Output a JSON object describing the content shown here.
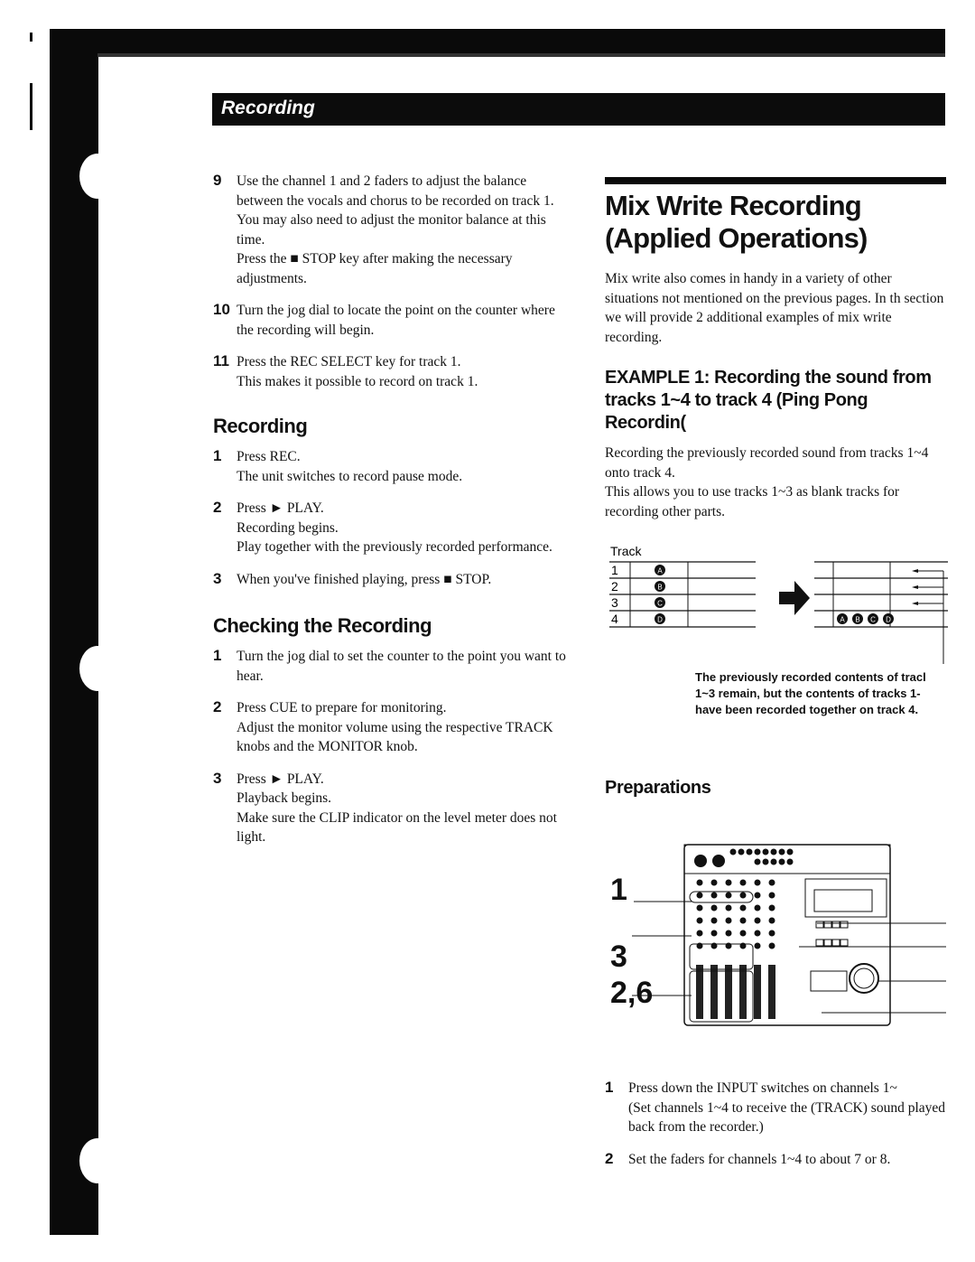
{
  "header": {
    "section": "Recording"
  },
  "left": {
    "steps_top": [
      {
        "n": "9",
        "lines": [
          "Use the channel 1 and 2 faders to adjust the balance between the vocals and chorus to be recorded on track 1.",
          "You may also need to adjust the monitor balance at this time.",
          "Press the ■ STOP key after making the necessary adjustments."
        ]
      },
      {
        "n": "10",
        "lines": [
          "Turn the jog dial to locate the point on the counter where the recording will begin."
        ]
      },
      {
        "n": "11",
        "lines": [
          "Press the REC SELECT key for track 1.",
          "This makes it possible to record on track 1."
        ]
      }
    ],
    "recording": {
      "title": "Recording",
      "steps": [
        {
          "n": "1",
          "lines": [
            "Press REC.",
            "The unit switches to record pause mode."
          ]
        },
        {
          "n": "2",
          "lines": [
            "Press ► PLAY.",
            "Recording begins.",
            "Play together with the previously recorded performance."
          ]
        },
        {
          "n": "3",
          "lines": [
            "When you've finished playing, press ■ STOP."
          ]
        }
      ]
    },
    "checking": {
      "title": "Checking the Recording",
      "steps": [
        {
          "n": "1",
          "lines": [
            "Turn the jog dial to set the counter to the point you want to hear."
          ]
        },
        {
          "n": "2",
          "lines": [
            "Press CUE to prepare for monitoring.",
            "Adjust the monitor volume using the respective TRACK knobs and the MONITOR knob."
          ]
        },
        {
          "n": "3",
          "lines": [
            "Press ► PLAY.",
            "Playback begins.",
            "Make sure the CLIP indicator on the level meter does not light."
          ]
        }
      ]
    }
  },
  "right": {
    "title": "Mix Write Recording (Applied Operations)",
    "intro": "Mix write also comes in handy in a variety of other situations not mentioned on the previous pages. In th section we will provide 2 additional examples of mix write recording.",
    "example_title": "EXAMPLE 1: Recording the sound from tracks 1~4 to track 4 (Ping Pong Recordin(",
    "example_text": [
      "Recording the previously recorded sound from tracks 1~4 onto track 4.",
      "This allows you to use tracks 1~3 as blank tracks for recording other parts."
    ],
    "diagram": {
      "track_label": "Track",
      "tracks": [
        "1",
        "2",
        "3",
        "4"
      ],
      "sources": [
        "A",
        "B",
        "C",
        "D"
      ],
      "caption": [
        "The previously recorded contents of tracl",
        "1~3 remain, but the contents of tracks 1-",
        "have been recorded together on track 4."
      ]
    },
    "prep_title": "Preparations",
    "callouts": [
      "1",
      "3",
      "2,6"
    ],
    "steps": [
      {
        "n": "1",
        "lines": [
          "Press down the INPUT switches on channels 1~",
          "(Set channels 1~4 to receive the (TRACK) sound played back from the recorder.)"
        ]
      },
      {
        "n": "2",
        "lines": [
          "Set the faders for channels 1~4 to about 7 or 8."
        ]
      }
    ]
  }
}
